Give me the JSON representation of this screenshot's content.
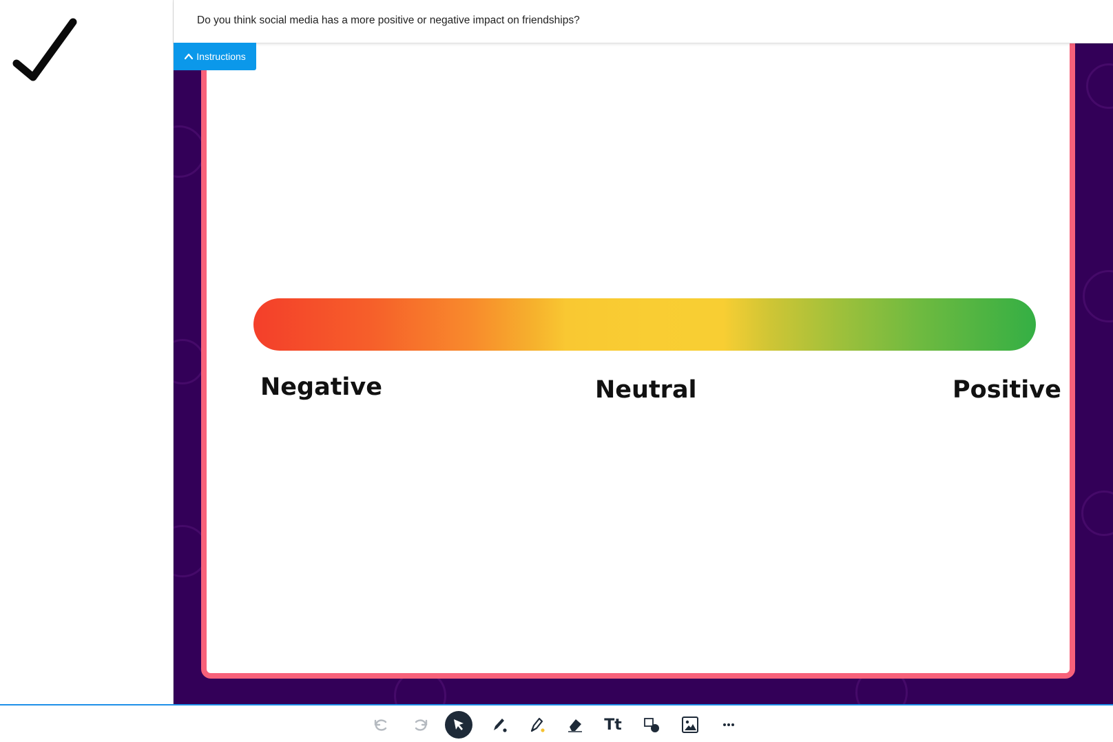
{
  "prompt": {
    "question": "Do you think social media has a more positive or negative impact on friendships?"
  },
  "instructions_button": {
    "label": "Instructions"
  },
  "scale": {
    "labels": {
      "negative": "Negative",
      "neutral": "Neutral",
      "positive": "Positive"
    },
    "colors": {
      "start": "#f43f2a",
      "middle": "#f9cd33",
      "end": "#34af44"
    }
  },
  "slide": {
    "border_color": "#f7617a",
    "background_color": "#330058"
  },
  "toolbar": {
    "tools": [
      "undo-icon",
      "redo-icon",
      "select-icon",
      "pen-icon",
      "highlighter-icon",
      "eraser-icon",
      "text-icon",
      "shapes-icon",
      "image-icon",
      "more-icon"
    ],
    "text_tool_label": "Tt",
    "accent": "#1e90e8"
  }
}
